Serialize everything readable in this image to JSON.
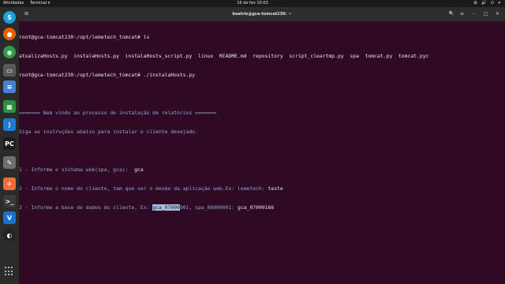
{
  "topbar": {
    "activities": "Atividades",
    "app": "Terminal ▾",
    "clock": "16 de fev  10:03",
    "tray": "⊞ 🔊 ⏻ ▾"
  },
  "dock": {
    "items": [
      {
        "name": "skype-icon",
        "glyph": "S",
        "color": "#1e9de0"
      },
      {
        "name": "firefox-icon",
        "glyph": "●",
        "color": "#e66000"
      },
      {
        "name": "chrome-icon",
        "glyph": "◉",
        "color": "#2e9b4a"
      },
      {
        "name": "files-icon",
        "glyph": "▭",
        "color": "#5a5a5a"
      },
      {
        "name": "text-editor-icon",
        "glyph": "≡",
        "color": "#4a7fd6"
      },
      {
        "name": "spreadsheet-icon",
        "glyph": "▦",
        "color": "#2f8f3e"
      },
      {
        "name": "vscode-icon",
        "glyph": "⟩",
        "color": "#1f7ad6"
      },
      {
        "name": "pycharm-icon",
        "glyph": "PC",
        "color": "#1d1d1d"
      },
      {
        "name": "gimp-icon",
        "glyph": "✎",
        "color": "#6e6e6e"
      },
      {
        "name": "postman-icon",
        "glyph": "✈",
        "color": "#ef6c34"
      },
      {
        "name": "terminal-icon",
        "glyph": ">_",
        "color": "#3a3a3a"
      },
      {
        "name": "vagrant-icon",
        "glyph": "V",
        "color": "#1c6fd1"
      },
      {
        "name": "obs-icon",
        "glyph": "◐",
        "color": "#222222"
      }
    ]
  },
  "window": {
    "title": "beatriz@gca-tomcat230: ~",
    "new_tab": "⊞",
    "search": "🔍",
    "menu": "≡",
    "minimize": "–",
    "maximize": "□",
    "close": "✕"
  },
  "terminal": {
    "l1": "root@gca-tomcat230:/opt/lemetech_tomcat# ls",
    "l2": "atualizaHosts.py  instalaHosts.py  instalaHosts_script.py  linux  README.md  repository  script_cleartmp.py  spa  tomcat.py  tomcat.pyc",
    "l3": "root@gca-tomcat230:/opt/lemetech_tomcat# ./instalaHosts.py",
    "l4": "",
    "l5": "======= Bem vindo ao processo de instalação de relatórios =======",
    "l6": "Siga as instruções abaixo para instalar o cliente desejado.",
    "l7": "",
    "l8_prompt": "1 - Informe o sistema web(spa, gca):",
    "l8_input": "  gca",
    "l9_prompt": "2 - Informe o nome do cliente, tem que ser o mesmo da aplicação web.Ex: lemetech:",
    "l9_input": " teste",
    "l10_prompt_a": "3 - Informe a base de dados do cliente, Ex: ",
    "l10_sel": "gca_07000",
    "l10_prompt_b": "001, spa_08000001:",
    "l10_input": " gca_07000166"
  }
}
